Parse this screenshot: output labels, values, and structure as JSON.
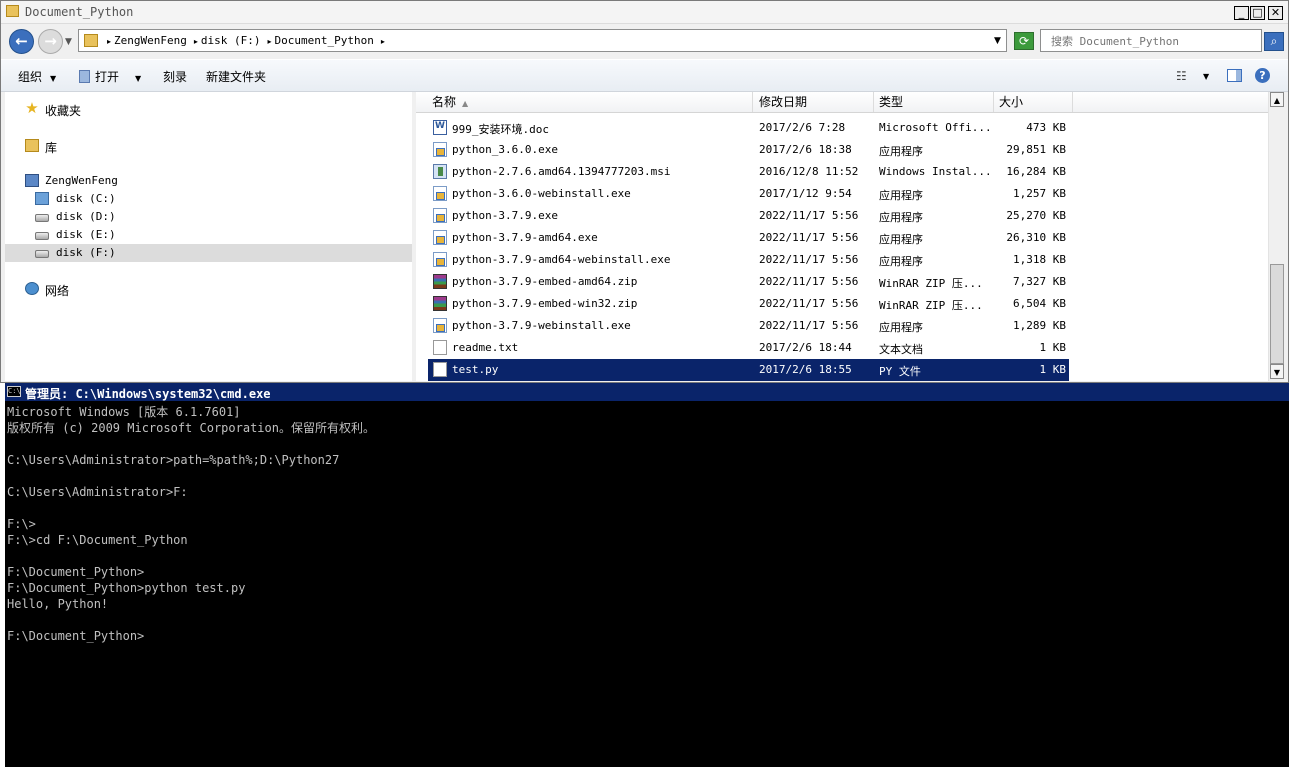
{
  "explorer": {
    "title": "Document_Python",
    "breadcrumbs": [
      "ZengWenFeng",
      "disk (F:)",
      "Document_Python"
    ],
    "search_placeholder": "搜索 Document_Python",
    "toolbar": {
      "organize": "组织",
      "open": "打开",
      "burn": "刻录",
      "new_folder": "新建文件夹"
    },
    "nav": {
      "favorites": "收藏夹",
      "libraries": "库",
      "computer": "ZengWenFeng",
      "drive_c": "disk (C:)",
      "drive_d": "disk (D:)",
      "drive_e": "disk (E:)",
      "drive_f": "disk (F:)",
      "network": "网络"
    },
    "columns": {
      "name": "名称",
      "date": "修改日期",
      "type": "类型",
      "size": "大小"
    },
    "files": [
      {
        "name": "999_安装环境.doc",
        "date": "2017/2/6 7:28",
        "type": "Microsoft Offi...",
        "size": "473 KB",
        "icon": "word-doc-icon"
      },
      {
        "name": "python_3.6.0.exe",
        "date": "2017/2/6 18:38",
        "type": "应用程序",
        "size": "29,851 KB",
        "icon": "exe-installer-icon"
      },
      {
        "name": "python-2.7.6.amd64.1394777203.msi",
        "date": "2016/12/8 11:52",
        "type": "Windows Instal...",
        "size": "16,284 KB",
        "icon": "msi-package-icon"
      },
      {
        "name": "python-3.6.0-webinstall.exe",
        "date": "2017/1/12 9:54",
        "type": "应用程序",
        "size": "1,257 KB",
        "icon": "exe-installer-icon"
      },
      {
        "name": "python-3.7.9.exe",
        "date": "2022/11/17 5:56",
        "type": "应用程序",
        "size": "25,270 KB",
        "icon": "exe-installer-icon"
      },
      {
        "name": "python-3.7.9-amd64.exe",
        "date": "2022/11/17 5:56",
        "type": "应用程序",
        "size": "26,310 KB",
        "icon": "exe-installer-icon"
      },
      {
        "name": "python-3.7.9-amd64-webinstall.exe",
        "date": "2022/11/17 5:56",
        "type": "应用程序",
        "size": "1,318 KB",
        "icon": "exe-installer-icon"
      },
      {
        "name": "python-3.7.9-embed-amd64.zip",
        "date": "2022/11/17 5:56",
        "type": "WinRAR ZIP 压...",
        "size": "7,327 KB",
        "icon": "winrar-zip-icon"
      },
      {
        "name": "python-3.7.9-embed-win32.zip",
        "date": "2022/11/17 5:56",
        "type": "WinRAR ZIP 压...",
        "size": "6,504 KB",
        "icon": "winrar-zip-icon"
      },
      {
        "name": "python-3.7.9-webinstall.exe",
        "date": "2022/11/17 5:56",
        "type": "应用程序",
        "size": "1,289 KB",
        "icon": "exe-installer-icon"
      },
      {
        "name": "readme.txt",
        "date": "2017/2/6 18:44",
        "type": "文本文档",
        "size": "1 KB",
        "icon": "text-file-icon"
      },
      {
        "name": "test.py",
        "date": "2017/2/6 18:55",
        "type": "PY 文件",
        "size": "1 KB",
        "icon": "text-file-icon",
        "selected": true
      }
    ]
  },
  "cmd": {
    "title": "管理员: C:\\Windows\\system32\\cmd.exe",
    "lines": [
      "Microsoft Windows [版本 6.1.7601]",
      "版权所有 (c) 2009 Microsoft Corporation。保留所有权利。",
      "",
      "C:\\Users\\Administrator>path=%path%;D:\\Python27",
      "",
      "C:\\Users\\Administrator>F:",
      "",
      "F:\\>",
      "F:\\>cd F:\\Document_Python",
      "",
      "F:\\Document_Python>",
      "F:\\Document_Python>python test.py",
      "Hello, Python!",
      "",
      "F:\\Document_Python>"
    ]
  }
}
